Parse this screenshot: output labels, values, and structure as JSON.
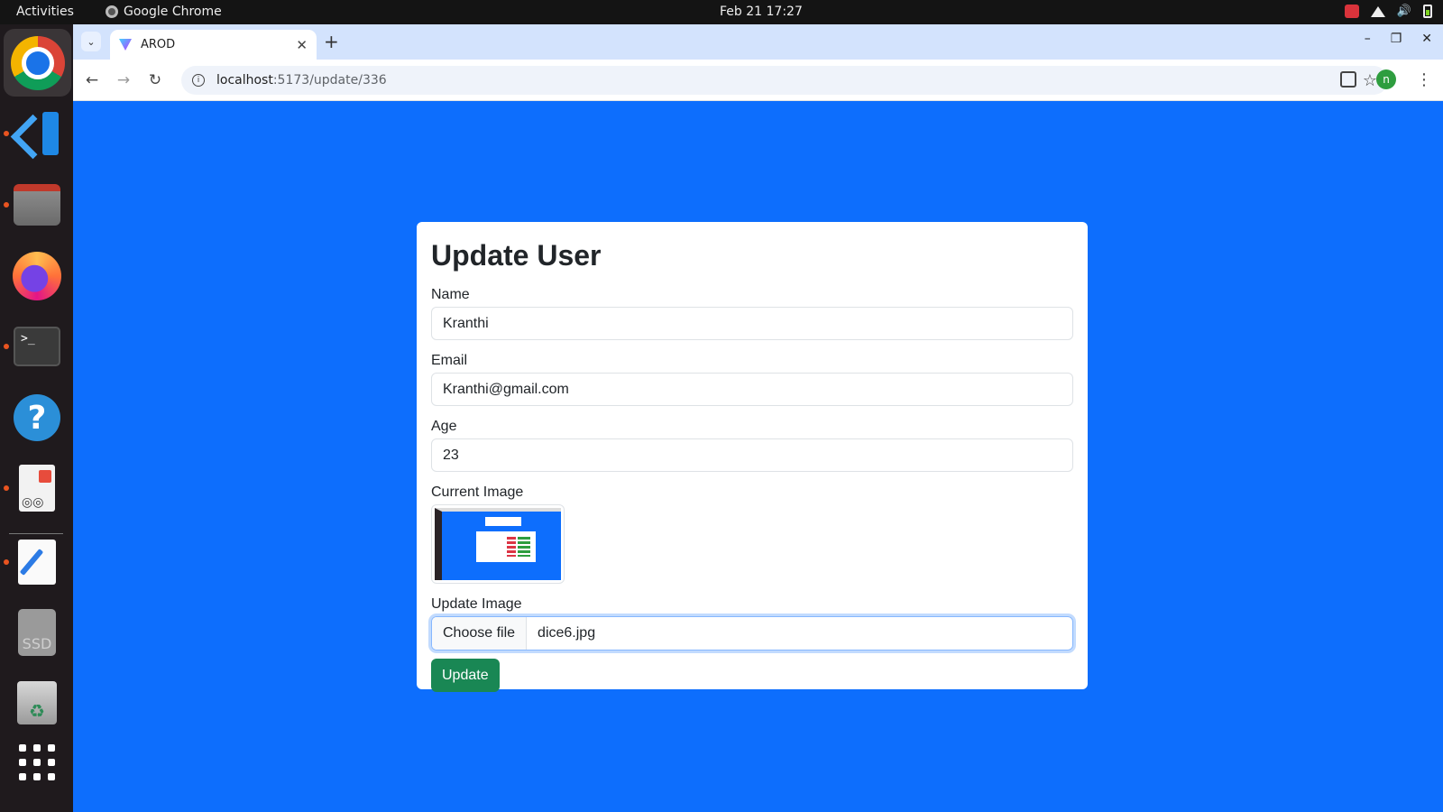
{
  "topbar": {
    "activities": "Activities",
    "app_name": "Google Chrome",
    "clock": "Feb 21  17:27"
  },
  "dock": {
    "items": [
      "chrome-icon",
      "vscode-icon",
      "files-icon",
      "firefox-icon",
      "terminal-icon",
      "help-icon",
      "document-viewer-icon",
      "text-editor-icon",
      "ssd-drive-icon",
      "trash-icon",
      "app-grid-icon"
    ],
    "ssd_label": "SSD"
  },
  "browser": {
    "tab_title": "AROD",
    "url_host": "localhost",
    "url_path": ":5173/update/336"
  },
  "form": {
    "title": "Update User",
    "name_label": "Name",
    "name_value": "Kranthi",
    "email_label": "Email",
    "email_value": "Kranthi@gmail.com",
    "age_label": "Age",
    "age_value": "23",
    "current_image_label": "Current Image",
    "update_image_label": "Update Image",
    "choose_file_label": "Choose file",
    "file_name": "dice6.jpg",
    "submit_label": "Update"
  },
  "colors": {
    "page_bg": "#0d6efd",
    "submit_bg": "#198754",
    "dock_bg": "#1f1a1d",
    "tabstrip_bg": "#d3e3fd"
  }
}
